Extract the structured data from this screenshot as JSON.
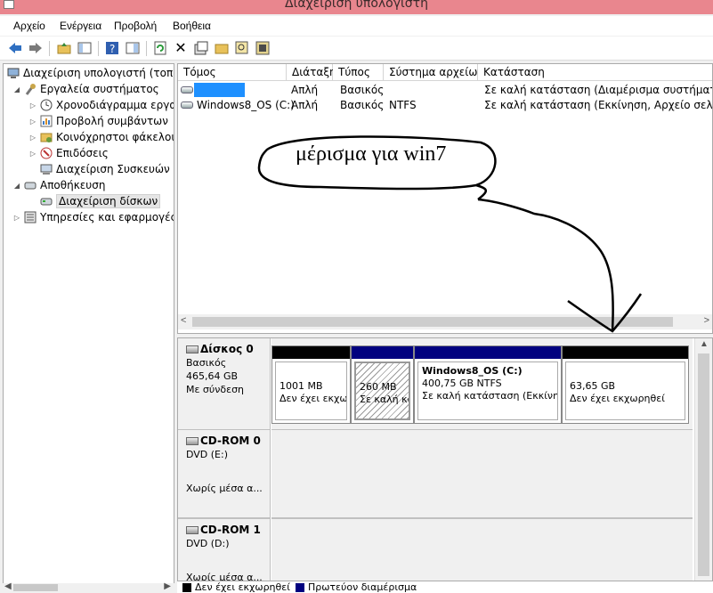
{
  "window": {
    "title": "Διαχείριση υπολογιστή"
  },
  "menu": {
    "items": [
      "Αρχείο",
      "Ενέργεια",
      "Προβολή",
      "Βοήθεια"
    ]
  },
  "toolbar": {
    "icons": [
      "back-arrow-icon",
      "forward-arrow-icon",
      "up-folder-icon",
      "show-hide-tree-icon",
      "help-icon",
      "properties-pane-icon",
      "refresh-icon",
      "delete-icon",
      "properties-icon",
      "open-folder-icon",
      "magnifier-icon"
    ],
    "colors": {
      "arrow": "#2f6fc1"
    }
  },
  "tree": {
    "items": [
      {
        "label": "Διαχείριση υπολογιστή (τοπικ",
        "icon": "computer-management-icon",
        "arrow": ""
      },
      {
        "label": "Εργαλεία συστήματος",
        "icon": "tools-icon",
        "arrow": "◢"
      },
      {
        "label": "Χρονοδιάγραμμα εργασ",
        "icon": "clock-icon",
        "arrow": "▷"
      },
      {
        "label": "Προβολή συμβάντων",
        "icon": "event-viewer-icon",
        "arrow": "▷"
      },
      {
        "label": "Κοινόχρηστοι φάκελοι",
        "icon": "shared-folder-icon",
        "arrow": "▷"
      },
      {
        "label": "Επιδόσεις",
        "icon": "performance-icon",
        "arrow": "▷"
      },
      {
        "label": "Διαχείριση Συσκευών",
        "icon": "device-manager-icon",
        "arrow": ""
      },
      {
        "label": "Αποθήκευση",
        "icon": "storage-icon",
        "arrow": "◢"
      },
      {
        "label": "Διαχείριση δίσκων",
        "icon": "disk-management-icon",
        "arrow": "",
        "selected": true
      },
      {
        "label": "Υπηρεσίες και εφαρμογές",
        "icon": "services-icon",
        "arrow": "▷"
      }
    ]
  },
  "volumes": {
    "columns": [
      "Τόμος",
      "Διάταξη",
      "Τύπος",
      "Σύστημα αρχείων",
      "Κατάσταση"
    ],
    "rows": [
      {
        "name": "",
        "layout": "Απλή",
        "type": "Βασικός",
        "fs": "",
        "status": "Σε καλή κατάσταση (Διαμέρισμα συστήματος Ε"
      },
      {
        "name": "Windows8_OS (C:)",
        "layout": "Απλή",
        "type": "Βασικός",
        "fs": "NTFS",
        "status": "Σε καλή κατάσταση (Εκκίνηση, Αρχείο σελιδοπ"
      }
    ]
  },
  "disks": [
    {
      "name": "Δίσκος 0",
      "line2": "Βασικός",
      "line3": "465,64 GB",
      "line4": "Με σύνδεση",
      "partitions": [
        {
          "size": "1001 MB",
          "status": "Δεν έχει εκχω",
          "bar": "#000000"
        },
        {
          "size": "260 MB",
          "status": "Σε καλή κα",
          "bar": "#00007f"
        },
        {
          "label": "Windows8_OS  (C:)",
          "size": "400,75 GB NTFS",
          "status": "Σε καλή κατάσταση (Εκκίνησ",
          "bar": "#00007f"
        },
        {
          "size": "63,65 GB",
          "status": "Δεν έχει εκχωρηθεί",
          "bar": "#000000"
        }
      ]
    },
    {
      "name": "CD-ROM 0",
      "line2": "DVD (E:)",
      "line3": "",
      "line4": "Χωρίς μέσα α..."
    },
    {
      "name": "CD-ROM 1",
      "line2": "DVD (D:)",
      "line3": "",
      "line4": "Χωρίς μέσα α..."
    }
  ],
  "legend": {
    "items": [
      {
        "label": "Δεν έχει εκχωρηθεί",
        "color": "#000000"
      },
      {
        "label": "Πρωτεύον διαμέρισμα",
        "color": "#00007f"
      }
    ]
  },
  "annotation": {
    "text": "μέρισμα για win7"
  }
}
